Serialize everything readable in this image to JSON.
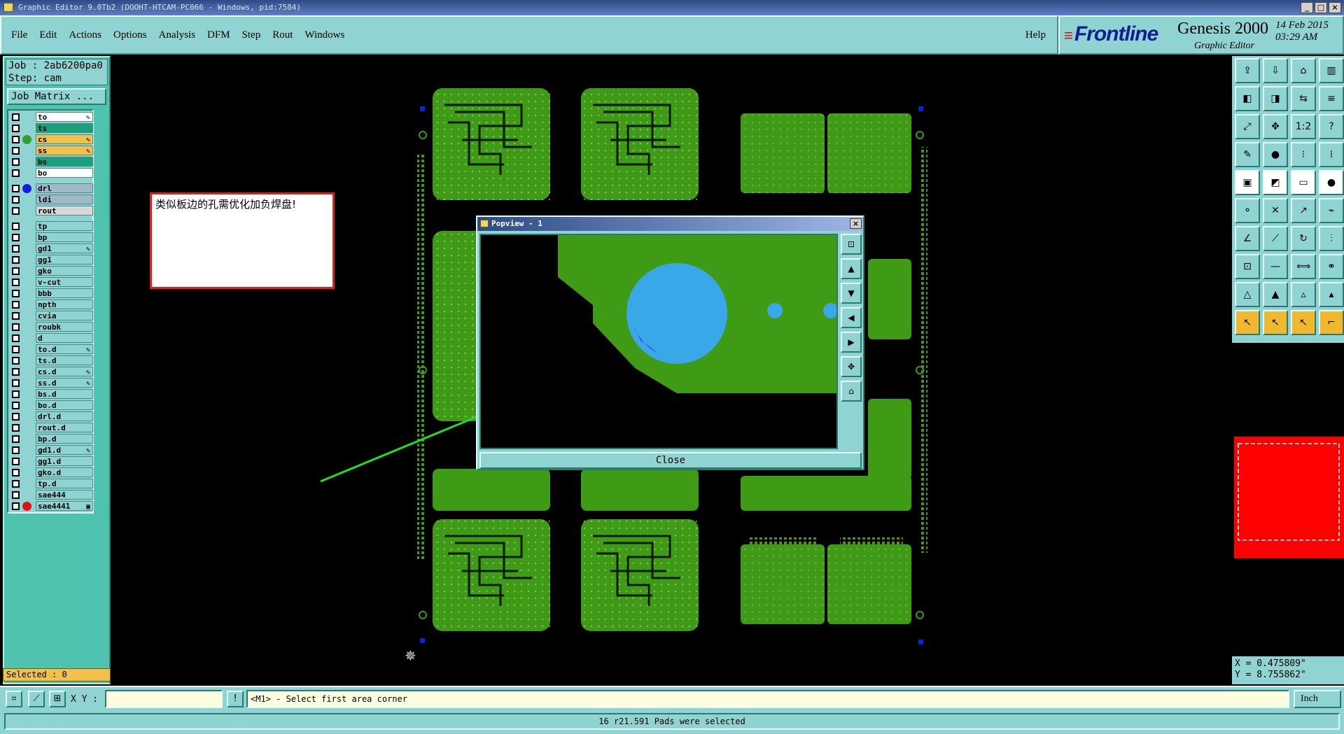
{
  "window": {
    "title": "Graphic Editor 9.0Tb2 (DOOHT-HTCAM-PC066 - Windows, pid:7584)",
    "buttons": [
      "_",
      "□",
      "×"
    ]
  },
  "menu": {
    "items": [
      "File",
      "Edit",
      "Actions",
      "Options",
      "Analysis",
      "DFM",
      "Step",
      "Rout",
      "Windows"
    ],
    "help": "Help"
  },
  "brand": {
    "logo": "Frontline",
    "product": "Genesis 2000",
    "subtitle": "Graphic Editor",
    "date": "14 Feb 2015",
    "time": "03:29 AM"
  },
  "job": {
    "job_line": "Job : 2ab6200pa0",
    "step_line": "Step: cam",
    "matrix_button": "Job Matrix ..."
  },
  "layers": {
    "group1": [
      {
        "name": "to",
        "color": "#ffffff",
        "dot": "",
        "edit": "✎"
      },
      {
        "name": "ts",
        "color": "#1aa07a",
        "dot": "",
        "edit": ""
      },
      {
        "name": "cs",
        "color": "#f0c24c",
        "dot": "#2fa02f",
        "edit": "✎"
      },
      {
        "name": "ss",
        "color": "#f0c24c",
        "dot": "",
        "edit": "✎"
      },
      {
        "name": "bs",
        "color": "#1aa07a",
        "dot": "",
        "edit": ""
      },
      {
        "name": "bo",
        "color": "#ffffff",
        "dot": "",
        "edit": ""
      }
    ],
    "group2": [
      {
        "name": "drl",
        "color": "#a0b8c8",
        "dot": "#1020e0",
        "edit": ""
      },
      {
        "name": "ldi",
        "color": "#a0b8c8",
        "dot": "",
        "edit": ""
      },
      {
        "name": "rout",
        "color": "#d8d8d8",
        "dot": "",
        "edit": ""
      }
    ],
    "group3": [
      {
        "name": "tp",
        "edit": ""
      },
      {
        "name": "bp",
        "edit": ""
      },
      {
        "name": "gd1",
        "edit": "✎"
      },
      {
        "name": "gg1",
        "edit": ""
      },
      {
        "name": "gko",
        "edit": ""
      },
      {
        "name": "v-cut",
        "edit": ""
      },
      {
        "name": "bbb",
        "edit": ""
      },
      {
        "name": "npth",
        "edit": ""
      },
      {
        "name": "cvia",
        "edit": ""
      },
      {
        "name": "roubk",
        "edit": ""
      },
      {
        "name": "d",
        "edit": ""
      },
      {
        "name": "to.d",
        "edit": "✎"
      },
      {
        "name": "ts.d",
        "edit": ""
      },
      {
        "name": "cs.d",
        "edit": "✎"
      },
      {
        "name": "ss.d",
        "edit": "✎"
      },
      {
        "name": "bs.d",
        "edit": ""
      },
      {
        "name": "bo.d",
        "edit": ""
      },
      {
        "name": "drl.d",
        "edit": ""
      },
      {
        "name": "rout.d",
        "edit": ""
      },
      {
        "name": "bp.d",
        "edit": ""
      },
      {
        "name": "gd1.d",
        "edit": "✎"
      },
      {
        "name": "gg1.d",
        "edit": ""
      },
      {
        "name": "gko.d",
        "edit": ""
      },
      {
        "name": "tp.d",
        "edit": ""
      },
      {
        "name": "sae444",
        "edit": ""
      },
      {
        "name": "sae4441",
        "edit": "▣",
        "dot": "#e01010"
      }
    ]
  },
  "selected": "Selected : 0",
  "annotation": {
    "text": "类似板边的孔需优化加负焊盘!",
    "border_color": "#e0201c",
    "arrow_color": "#20e020"
  },
  "popview": {
    "title": "Popview - 1",
    "close_label": "Close",
    "tool_icons": [
      "zoom-window-icon",
      "pan-up-icon",
      "pan-down-icon",
      "pan-left-icon",
      "pan-right-icon",
      "zoom-fit-icon",
      "zoom-home-icon"
    ]
  },
  "toolbar": {
    "icons": [
      "home-icon",
      "save-icon",
      "house-icon",
      "grid-icon",
      "open-left-icon",
      "open-right-icon",
      "flip-icon",
      "align-icon",
      "fit-icon",
      "center-icon",
      "ratio-icon",
      "help-icon",
      "snap-icon",
      "pad-icon",
      "measure-icon",
      "net-icon",
      "pad-add-icon",
      "polygon-icon",
      "keyboard-icon",
      "circle-icon",
      "connect-icon",
      "cross-icon",
      "node-icon",
      "link-icon",
      "line-icon",
      "arc-icon",
      "rotate-icon",
      "mirror-icon",
      "pad-red-icon",
      "line-red-icon",
      "measure-line-icon",
      "multi-circle-icon",
      "triangle-icon",
      "triangle-a-icon",
      "triangle-b-icon",
      "triangle-c-icon",
      "select-icon",
      "select-box-icon",
      "select-net-icon",
      "route-icon"
    ]
  },
  "coords": {
    "x": "X = 0.475809\"",
    "y": "Y = 8.755862\""
  },
  "status": {
    "xy_label": "X Y :",
    "message": "<M1> - Select first area corner",
    "unit": "Inch",
    "info": "16 r21.591 Pads were selected"
  },
  "colors": {
    "teal": "#8fd3d3",
    "board": "#3f9a16",
    "pad": "#3aa8e8"
  }
}
